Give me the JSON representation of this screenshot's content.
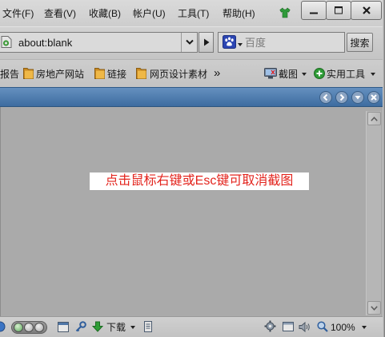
{
  "menu": {
    "items": [
      {
        "label": "文件(F)"
      },
      {
        "label": "查看(V)"
      },
      {
        "label": "收藏(B)"
      },
      {
        "label": "帐户(U)"
      },
      {
        "label": "工具(T)"
      },
      {
        "label": "帮助(H)"
      }
    ],
    "skin_icon": "tshirt-icon",
    "window_controls": [
      "minimize-icon",
      "maximize-icon",
      "close-icon"
    ]
  },
  "address": {
    "page_icon": "page-icon",
    "value": "about:blank",
    "dropdown_icon": "chevron-down-icon",
    "go_icon": "go-arrow-icon"
  },
  "search": {
    "engine_icon": "baidu-paw-icon",
    "placeholder": "百度",
    "button_label": "搜索"
  },
  "bookmarks": {
    "items": [
      {
        "label": "报告"
      },
      {
        "label": "房地产网站",
        "icon": "folder-icon"
      },
      {
        "label": "链接",
        "icon": "folder-icon"
      },
      {
        "label": "网页设计素材",
        "icon": "folder-icon"
      }
    ],
    "overflow": "»",
    "tools": [
      {
        "label": "截图",
        "icon": "screenshot-icon"
      },
      {
        "label": "实用工具",
        "icon": "plus-circle-icon"
      }
    ]
  },
  "tabbar": {
    "controls": [
      "back-icon",
      "forward-icon",
      "tab-list-icon",
      "close-tab-icon"
    ]
  },
  "content": {
    "overlay_message": "点击鼠标右键或Esc键可取消截图"
  },
  "status": {
    "left_icons": [
      "globe-icon",
      "toggle-switch",
      "window-icon",
      "key-icon",
      "download-icon",
      "clipboard-icon"
    ],
    "download_label": "下载",
    "right_icons": [
      "gear-icon",
      "fullscreen-icon",
      "speaker-icon",
      "magnifier-icon"
    ],
    "zoom": "100%"
  },
  "colors": {
    "chrome": "#c9c9c9",
    "tabbar": "#4a79ad",
    "content": "#aaaaaa",
    "overlay_text": "#e3241d",
    "overlay_bg": "#ffffff",
    "folder": "#efb847",
    "accent_green": "#2e9b36"
  }
}
